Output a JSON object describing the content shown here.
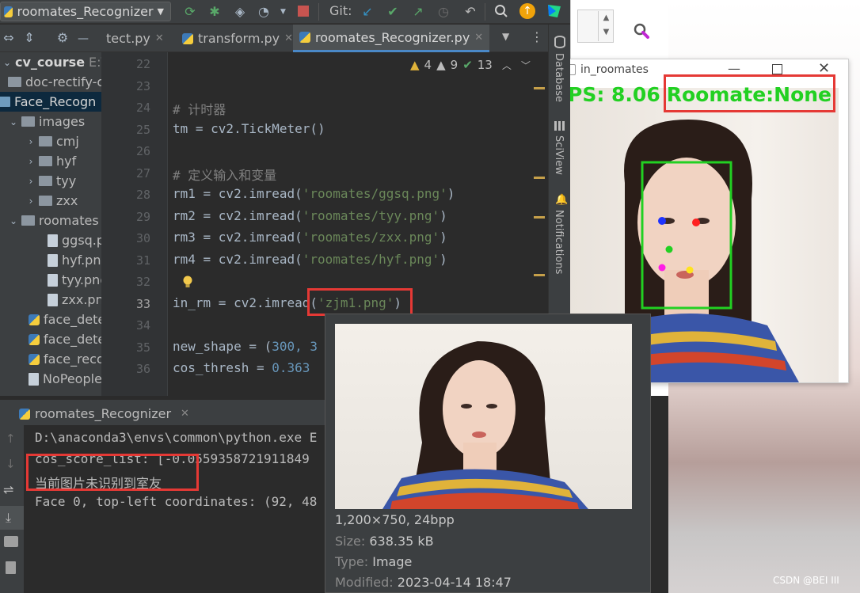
{
  "toolbar": {
    "run_config": "roomates_Recognizer",
    "git_label": "Git:"
  },
  "tabs": [
    {
      "label": "tect.py"
    },
    {
      "label": "transform.py"
    },
    {
      "label": "roomates_Recognizer.py"
    }
  ],
  "tree": {
    "project": "cv_course",
    "project_path": "E:\\Py",
    "items": [
      {
        "label": "doc-rectify-c"
      },
      {
        "label": "Face_Recogn"
      },
      {
        "label": "images"
      },
      {
        "label": "cmj"
      },
      {
        "label": "hyf"
      },
      {
        "label": "tyy"
      },
      {
        "label": "zxx"
      },
      {
        "label": "roomates"
      },
      {
        "label": "ggsq.p"
      },
      {
        "label": "hyf.png"
      },
      {
        "label": "tyy.png"
      },
      {
        "label": "zxx.pn"
      },
      {
        "label": "face_dete"
      },
      {
        "label": "face_dete"
      },
      {
        "label": "face_reco"
      },
      {
        "label": "NoPeople"
      }
    ]
  },
  "editor": {
    "inspections": {
      "warnings": "4",
      "weak": "9",
      "ok": "13"
    },
    "lines": [
      {
        "n": "22"
      },
      {
        "n": "23"
      },
      {
        "n": "24",
        "comment": "# 计时器"
      },
      {
        "n": "25",
        "code": "tm = cv2.TickMeter()"
      },
      {
        "n": "26"
      },
      {
        "n": "27",
        "comment": "# 定义输入和变量"
      },
      {
        "n": "28",
        "pre": "rm1 = cv2.imread(",
        "str": "'roomates/ggsq.png'",
        "post": ")"
      },
      {
        "n": "29",
        "pre": "rm2 = cv2.imread(",
        "str": "'roomates/tyy.png'",
        "post": ")"
      },
      {
        "n": "30",
        "pre": "rm3 = cv2.imread(",
        "str": "'roomates/zxx.png'",
        "post": ")"
      },
      {
        "n": "31",
        "pre": "rm4 = cv2.imread(",
        "str": "'roomates/hyf.png'",
        "post": ")"
      },
      {
        "n": "32"
      },
      {
        "n": "33",
        "pre": "in_rm = cv2.imread(",
        "str": "'zjm1.png'",
        "post": ")"
      },
      {
        "n": "34"
      },
      {
        "n": "35",
        "pre": "new_shape = (",
        "num": "300, 3",
        "post": ""
      },
      {
        "n": "36",
        "pre": "cos_thresh = ",
        "num": "0.363",
        "post": ""
      }
    ]
  },
  "right_strip": {
    "database": "Database",
    "sciview": "SciView",
    "notifications": "Notifications"
  },
  "run": {
    "title": "roomates_Recognizer",
    "console": [
      "D:\\anaconda3\\envs\\common\\python.exe E",
      "cos_score_list:  [-0.0559358721911849",
      "当前图片未识别到室友",
      "Face 0, top-left coordinates: (92, 48"
    ]
  },
  "popup": {
    "dims": "1,200×750, 24bpp",
    "size_label": "Size:",
    "size_value": "638.35 kB",
    "type_label": "Type:",
    "type_value": "Image",
    "modified_label": "Modified:",
    "modified_value": "2023-04-14 18:47"
  },
  "cv_window": {
    "title": "in_roomates",
    "overlay_fps": "PS:  8.06",
    "overlay_result": "Roomate:None"
  },
  "watermark": "CSDN @BEI III",
  "colors": {
    "accent": "#4a88c7",
    "highlight_box": "#e53935",
    "overlay_text": "#00ff00"
  }
}
